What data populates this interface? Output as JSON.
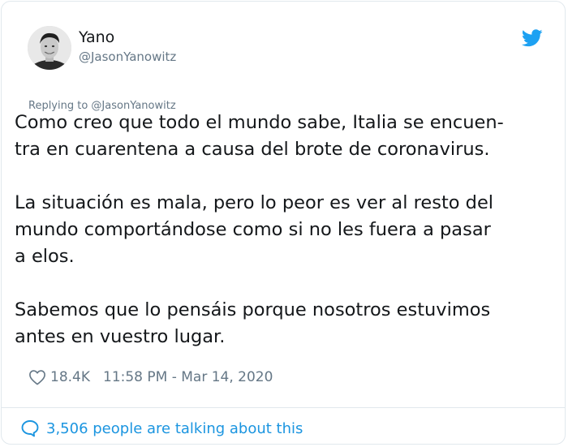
{
  "author": {
    "display_name": "Yano",
    "handle": "@JasonYanowitz"
  },
  "icons": {
    "logo": "twitter-bird-icon",
    "like": "heart-icon",
    "conversation": "speech-bubble-icon"
  },
  "colors": {
    "accent": "#1da1f2",
    "link": "#1b95e0",
    "secondary_text": "#657786",
    "primary_text": "#14171a",
    "border": "#e1e8ed"
  },
  "tweet": {
    "replying_to": "Replying to @JasonYanowitz",
    "lines": [
      "Como creo que todo el mundo sabe, Italia se encuen-",
      "tra en cuarentena a causa del brote de coronavirus.",
      "La situación es mala, pero lo peor es ver al resto del",
      "mundo comportándose como si no les fuera a pasar",
      "a elos.",
      "Sabemos que lo pensáis porque nosotros estuvimos",
      "antes en vuestro lugar."
    ],
    "likes": "18.4K",
    "timestamp": "11:58 PM - Mar 14, 2020"
  },
  "footer": {
    "talking": "3,506 people are talking about this"
  }
}
